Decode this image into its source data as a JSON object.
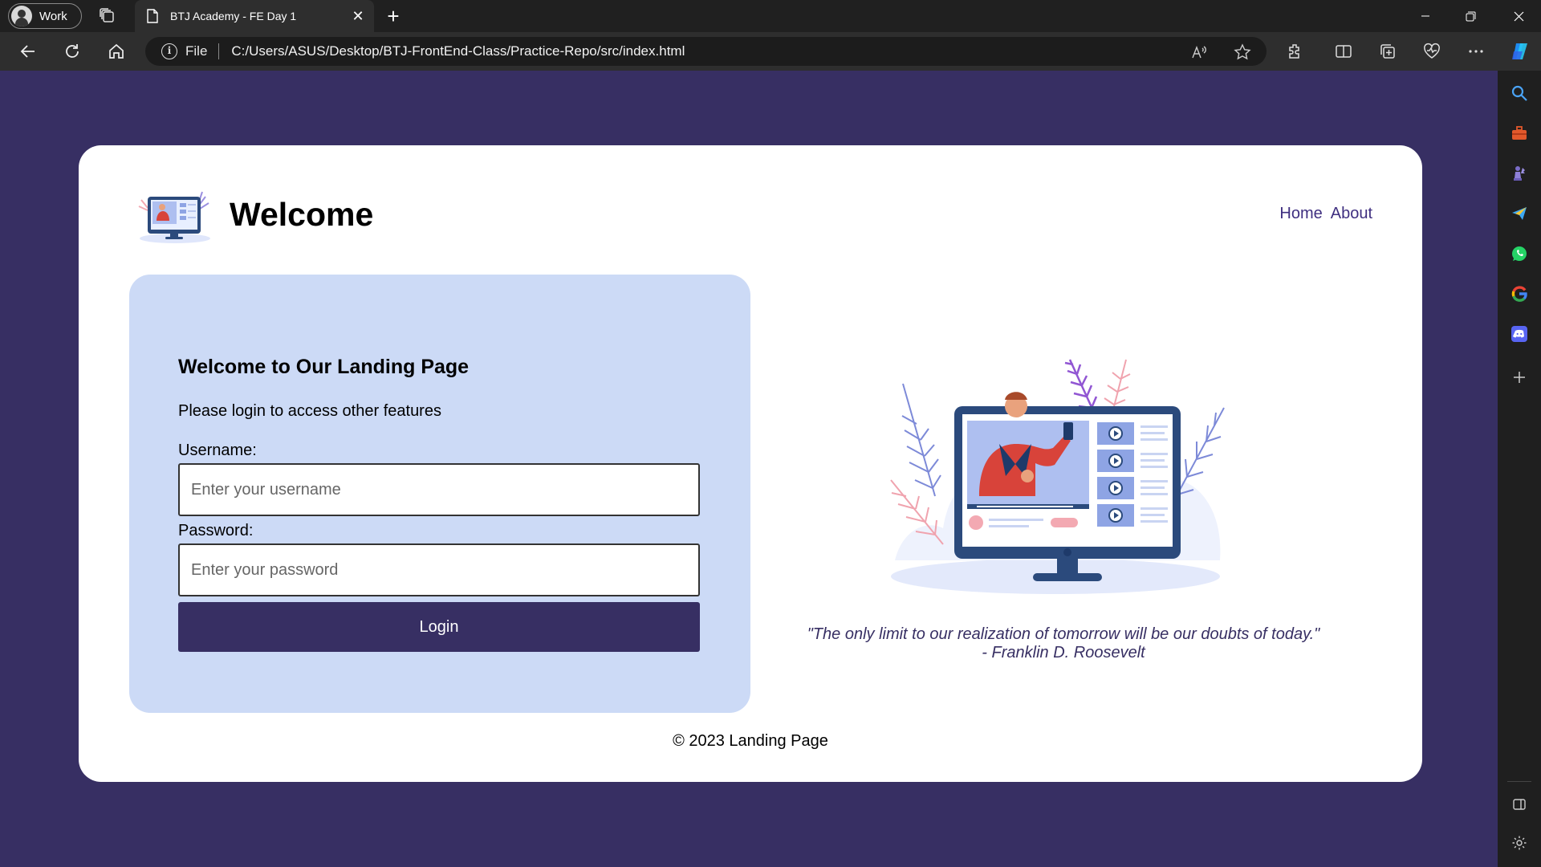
{
  "browser": {
    "profile_label": "Work",
    "tab_title": "BTJ Academy - FE Day 1",
    "url_scheme_label": "File",
    "url": "C:/Users/ASUS/Desktop/BTJ-FrontEnd-Class/Practice-Repo/src/index.html"
  },
  "page": {
    "title": "Welcome",
    "nav": [
      "Home",
      "About"
    ],
    "login": {
      "heading": "Welcome to Our Landing Page",
      "subtitle": "Please login to access other features",
      "username_label": "Username:",
      "username_placeholder": "Enter your username",
      "password_label": "Password:",
      "password_placeholder": "Enter your password",
      "button_label": "Login"
    },
    "quote": {
      "text": "\"The only limit to our realization of tomorrow will be our doubts of today.\"",
      "author": "- Franklin D. Roosevelt"
    },
    "footer": "© 2023 Landing Page"
  },
  "colors": {
    "page_background": "#372f63",
    "card_background": "#ffffff",
    "login_panel": "#ccdaf6",
    "button": "#372f63",
    "link": "#3f2f80"
  },
  "icons": {
    "sidebar": [
      "search-icon",
      "toolbox-icon",
      "chess-icon",
      "send-icon",
      "whatsapp-icon",
      "google-icon",
      "discord-icon",
      "add-icon",
      "sidebar-toggle-icon",
      "settings-icon"
    ]
  }
}
